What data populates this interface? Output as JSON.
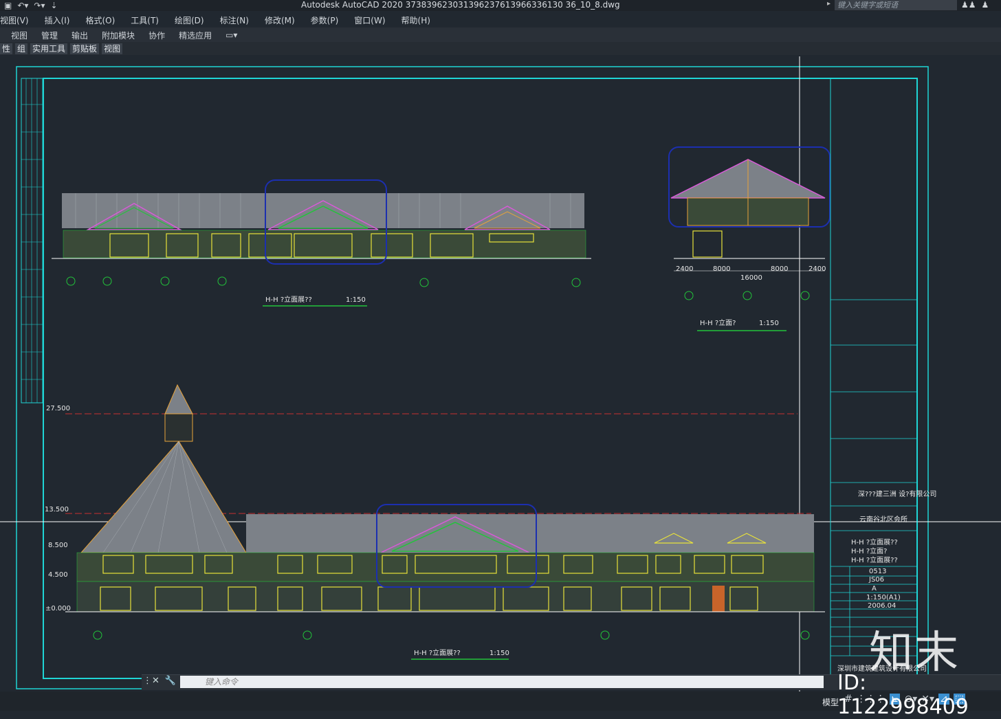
{
  "window": {
    "title": "Autodesk AutoCAD 2020    373839623031396237613966336130 36_10_8.dwg",
    "search_placeholder": "键入关键字或短语"
  },
  "menu": [
    "视图(V)",
    "插入(I)",
    "格式(O)",
    "工具(T)",
    "绘图(D)",
    "标注(N)",
    "修改(M)",
    "参数(P)",
    "窗口(W)",
    "帮助(H)"
  ],
  "ribbon_tabs": [
    "视图",
    "管理",
    "输出",
    "附加模块",
    "协作",
    "精选应用"
  ],
  "panels": [
    "性",
    "组",
    "实用工具",
    "剪贴板",
    "视图"
  ],
  "drawing": {
    "elevation1_title": "H-H ?立面展??",
    "elevation1_scale": "1:150",
    "elevation2_title": "H-H ?立面?",
    "elevation2_scale": "1:150",
    "elevation3_title": "H-H ?立面展??",
    "elevation3_scale": "1:150",
    "dims_side": [
      "2400",
      "8000",
      "8000",
      "2400",
      "16000"
    ],
    "levels": [
      "±0.000",
      "4.500",
      "8.500",
      "13.500",
      "27.500"
    ],
    "titleblock": {
      "company": "深???建三洲 设?有限公司",
      "project": "云南谷北区会所",
      "drawing_names": [
        "H-H ?立面展??",
        "H-H ?立面?",
        "H-H ?立面展??"
      ],
      "number": "0513",
      "sheet": "JS06",
      "grade": "A",
      "scale": "1:150(A1)",
      "date": "2006.04",
      "footer": "深圳市建筑建筑设计有限公司"
    }
  },
  "command": {
    "placeholder": "键入命令"
  },
  "status": {
    "model": "模型"
  },
  "watermark": {
    "logo": "知末",
    "id": "ID: 1122998409"
  },
  "colors": {
    "background": "#212830",
    "frame": "#1fd6d6",
    "wall_yellow": "#e8e23a",
    "roof_grey": "#8d9299",
    "highlight_blue": "#1c2fb0",
    "green": "#22c43a"
  }
}
